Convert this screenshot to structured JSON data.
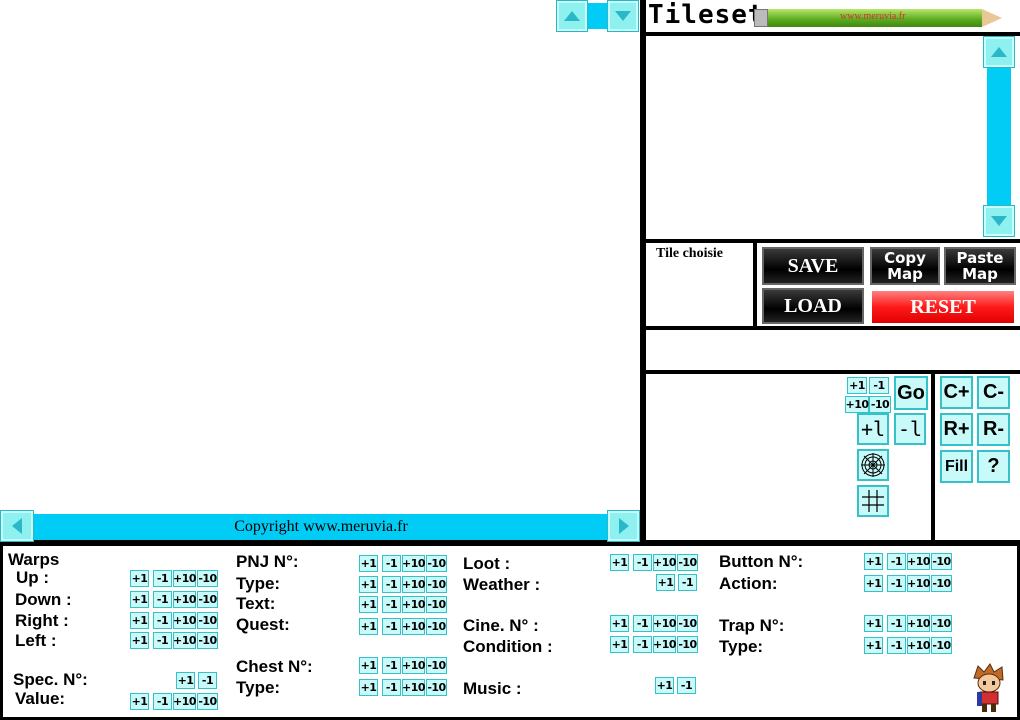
{
  "map_scroll": {
    "up_icon": "triangle-up",
    "down_icon": "triangle-down",
    "left_icon": "triangle-left",
    "right_icon": "triangle-right"
  },
  "copyright": "Copyright www.meruvia.fr",
  "tileset": {
    "title": "Tileset",
    "pencil_text": "www.meruvia.fr"
  },
  "tile_choisie": "Tile choisie",
  "buttons": {
    "save": "SAVE",
    "load": "LOAD",
    "copy_map_1": "Copy",
    "copy_map_2": "Map",
    "paste_map_1": "Paste",
    "paste_map_2": "Map",
    "reset": "RESET"
  },
  "tools": {
    "p1": "+1",
    "m1": "-1",
    "p10": "+10",
    "m10": "-10",
    "go": "Go",
    "plus_l": "+l",
    "minus_l": "-l",
    "c_plus": "C+",
    "c_minus": "C-",
    "r_plus": "R+",
    "r_minus": "R-",
    "fill": "Fill",
    "help": "?"
  },
  "steps": {
    "p1": "+1",
    "m1": "-1",
    "p10": "+10",
    "m10": "-10"
  },
  "props": {
    "warps": "Warps",
    "up": "Up :",
    "down": "Down :",
    "right": "Right :",
    "left": "Left :",
    "spec": "Spec. N°:",
    "value": "Value:",
    "pnj": "PNJ N°:",
    "type": "Type:",
    "text": "Text:",
    "quest": "Quest:",
    "chest": "Chest N°:",
    "chest_type": "Type:",
    "loot": "Loot :",
    "weather": "Weather :",
    "cine": "Cine. N° :",
    "condition": "Condition :",
    "music": "Music :",
    "button": "Button N°:",
    "action": "Action:",
    "trap": "Trap N°:",
    "trap_type": "Type:"
  },
  "colors": {
    "accent": "#00ccf5",
    "button_bg": "#c8fafa",
    "reset": "#ff1a1a"
  }
}
